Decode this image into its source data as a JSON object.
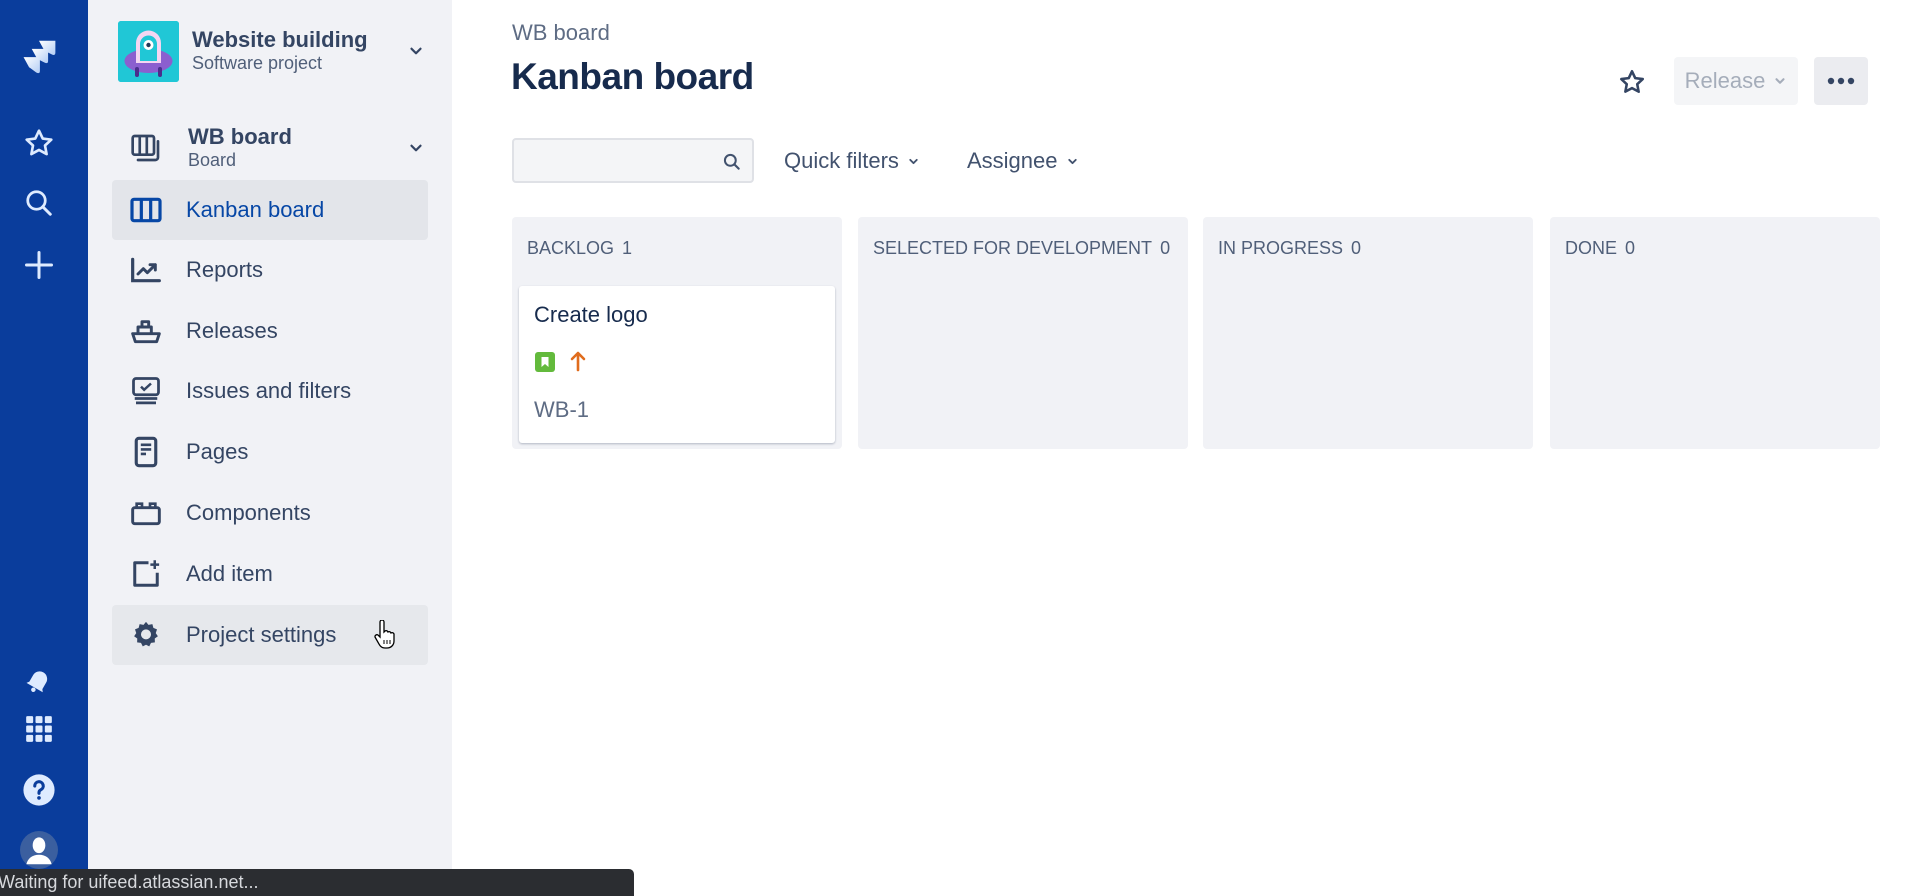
{
  "global_nav": {
    "items": [
      {
        "name": "jira-logo",
        "icon": "jira-logo"
      },
      {
        "name": "starred",
        "icon": "star-icon"
      },
      {
        "name": "search",
        "icon": "search-icon"
      },
      {
        "name": "create",
        "icon": "plus-icon"
      },
      {
        "name": "notifications",
        "icon": "bell-icon"
      },
      {
        "name": "app-switcher",
        "icon": "grid-icon"
      },
      {
        "name": "help",
        "icon": "help-icon"
      },
      {
        "name": "profile",
        "icon": "avatar-icon"
      }
    ],
    "colors": {
      "background": "#0a3d9c",
      "icon": "#deebff"
    }
  },
  "sidebar": {
    "project": {
      "name": "Website building",
      "type": "Software project"
    },
    "board": {
      "name": "WB board",
      "type": "Board"
    },
    "items": [
      {
        "label": "Kanban board",
        "icon": "board-columns-icon",
        "active": true
      },
      {
        "label": "Reports",
        "icon": "chart-line-icon"
      },
      {
        "label": "Releases",
        "icon": "ship-icon"
      },
      {
        "label": "Issues and filters",
        "icon": "issues-icon"
      },
      {
        "label": "Pages",
        "icon": "page-icon"
      },
      {
        "label": "Components",
        "icon": "component-icon"
      },
      {
        "label": "Add item",
        "icon": "add-item-icon"
      },
      {
        "label": "Project settings",
        "icon": "gear-icon",
        "hover": true
      }
    ]
  },
  "header": {
    "breadcrumb": "WB board",
    "title": "Kanban board",
    "release_label": "Release",
    "star_icon": "star-icon",
    "more_icon": "more-icon"
  },
  "filters": {
    "search_value": "",
    "search_placeholder": "",
    "quick_filters_label": "Quick filters",
    "assignee_label": "Assignee"
  },
  "board": {
    "columns": [
      {
        "title": "BACKLOG",
        "count": "1",
        "cards": [
          {
            "summary": "Create logo",
            "key": "WB-1",
            "type": "story",
            "priority": "high"
          }
        ]
      },
      {
        "title": "SELECTED FOR DEVELOPMENT",
        "count": "0",
        "cards": []
      },
      {
        "title": "IN PROGRESS",
        "count": "0",
        "cards": []
      },
      {
        "title": "DONE",
        "count": "0",
        "cards": []
      }
    ],
    "colors": {
      "story": "#63ba3c",
      "priority_high": "#e06c1d",
      "column_bg": "#f1f2f6"
    }
  },
  "status_bar": {
    "text": "Waiting for uifeed.atlassian.net..."
  }
}
